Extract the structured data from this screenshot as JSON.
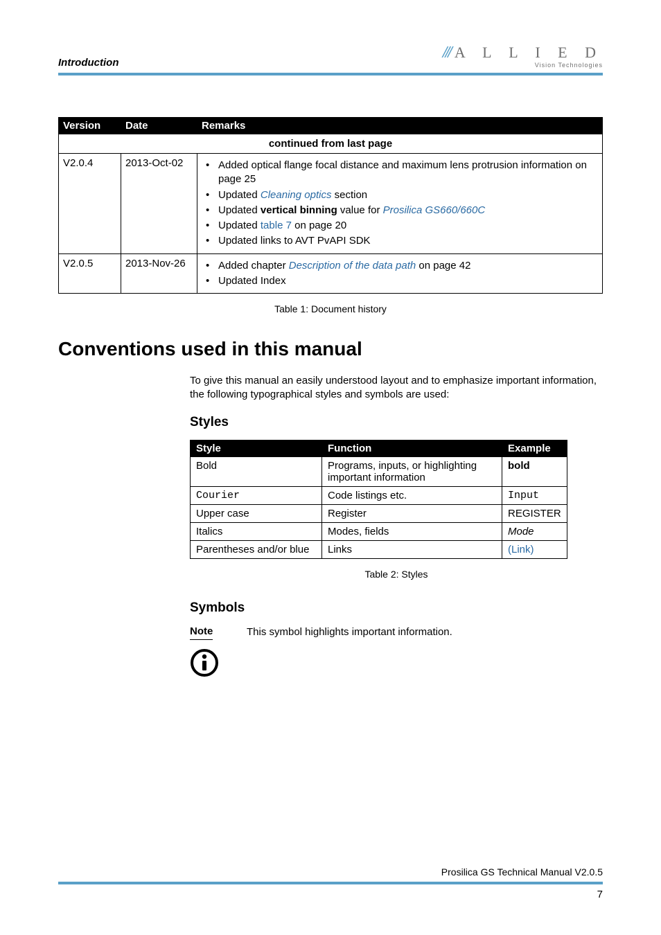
{
  "header": {
    "section": "Introduction",
    "logo_main": "A L L I E D",
    "logo_sub": "Vision Technologies"
  },
  "history": {
    "columns": {
      "c1": "Version",
      "c2": "Date",
      "c3": "Remarks"
    },
    "continued": "continued from last page",
    "rows": [
      {
        "version": "V2.0.4",
        "date": "2013-Oct-02",
        "remarks": [
          {
            "pre": "Added optical flange focal distance and maximum lens protrusion information on page 25"
          },
          {
            "pre": "Updated ",
            "link": "Cleaning optics",
            "post": " section"
          },
          {
            "pre": "Updated ",
            "bold": "vertical binning",
            "mid": " value for ",
            "link": "Prosilica GS660/660C"
          },
          {
            "pre": "Updated ",
            "linkn": "table 7",
            "post": " on page 20"
          },
          {
            "pre": "Updated links to AVT PvAPI SDK"
          }
        ]
      },
      {
        "version": "V2.0.5",
        "date": "2013-Nov-26",
        "remarks": [
          {
            "pre": "Added chapter  ",
            "link": "Description of the data path",
            "post": " on page 42"
          },
          {
            "pre": "Updated Index"
          }
        ]
      }
    ],
    "caption": "Table 1: Document history"
  },
  "conventions": {
    "heading": "Conventions used in this manual",
    "intro": "To give this manual an easily understood layout and to emphasize important information, the following typographical styles and symbols are used:",
    "styles_heading": "Styles",
    "styles_table": {
      "columns": {
        "c1": "Style",
        "c2": "Function",
        "c3": "Example"
      },
      "rows": [
        {
          "style": "Bold",
          "func": "Programs, inputs, or highlighting important information",
          "example": "bold",
          "ex_class": "bold"
        },
        {
          "style": "Courier",
          "style_class": "mono",
          "func": "Code listings etc.",
          "example": "Input",
          "ex_class": "mono"
        },
        {
          "style": "Upper case",
          "func": "Register",
          "example": "REGISTER"
        },
        {
          "style": "Italics",
          "func": "Modes, fields",
          "example": "Mode",
          "ex_class": "italic"
        },
        {
          "style": "Parentheses and/or blue",
          "func": "Links",
          "example": "(Link)",
          "ex_class": "link-blue-n"
        }
      ],
      "caption": "Table 2: Styles"
    },
    "symbols_heading": "Symbols",
    "note_label": "Note",
    "note_text": "This symbol highlights important information."
  },
  "footer": {
    "text": "Prosilica GS Technical Manual  V2.0.5",
    "page": "7"
  }
}
